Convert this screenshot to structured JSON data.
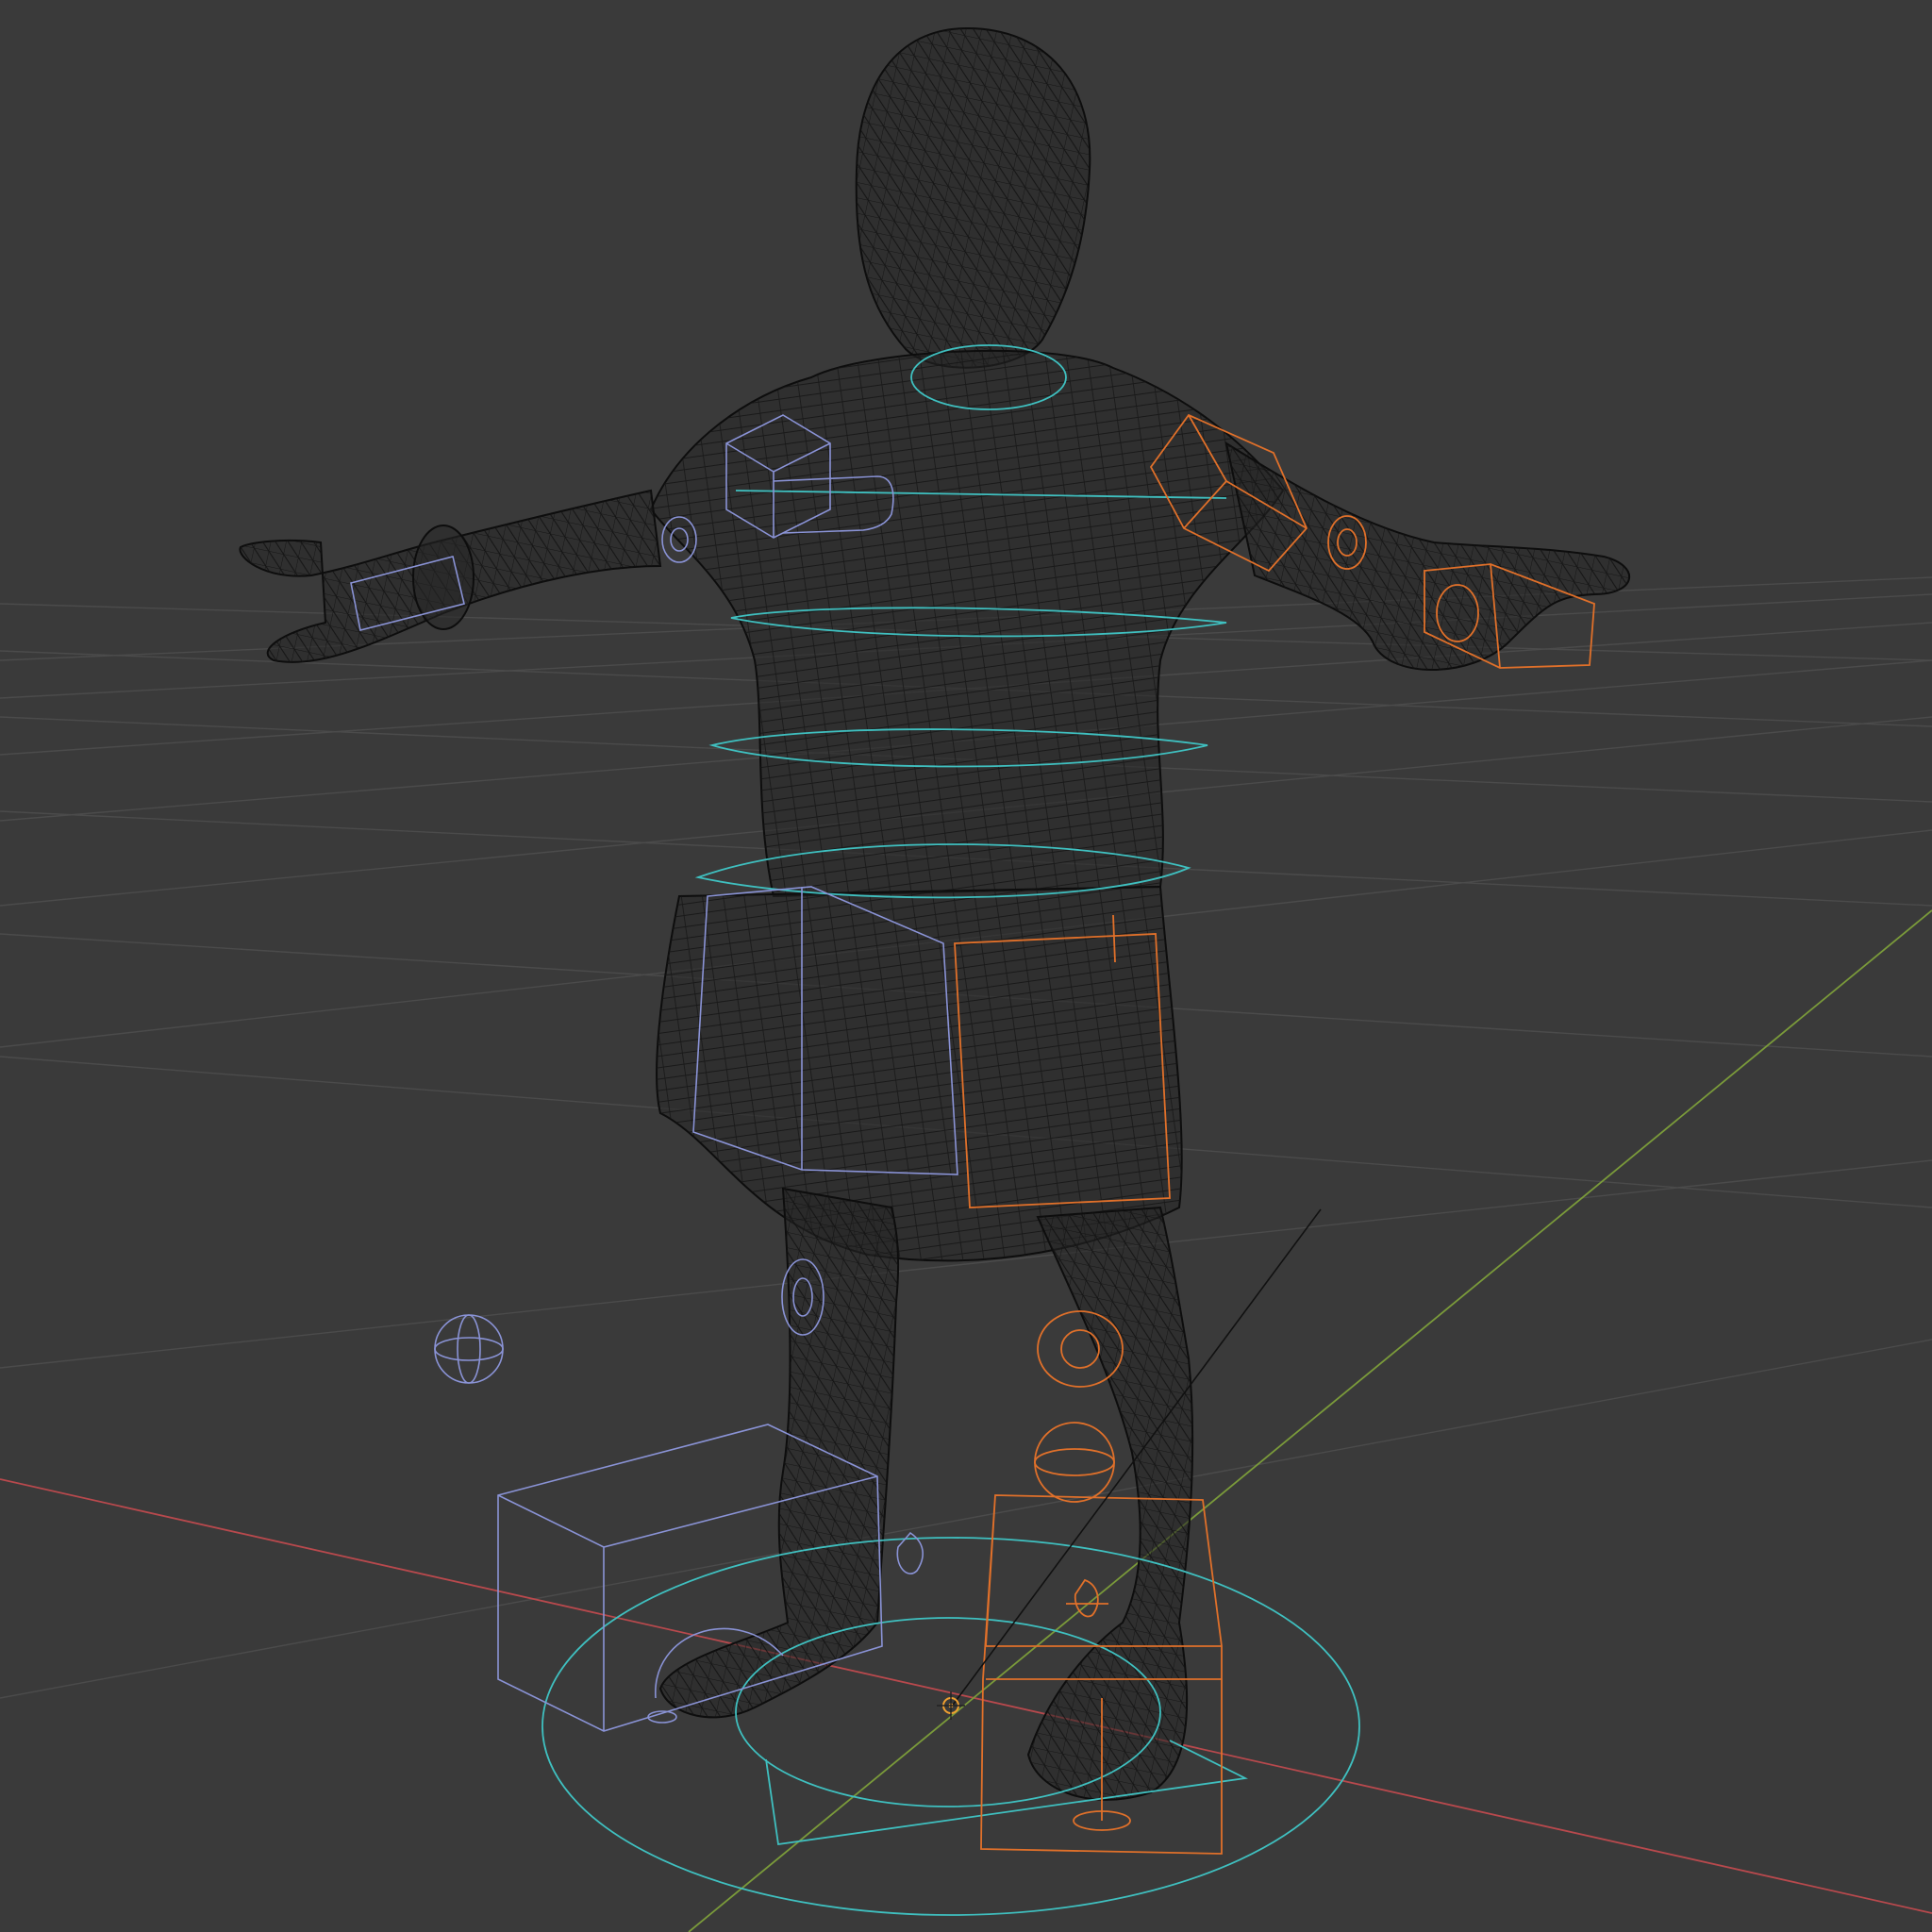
{
  "viewport": {
    "background": "#3a3a3a",
    "shading": "wireframe",
    "colors": {
      "grid": "#4b4b4b",
      "x_axis": "#b8494d",
      "y_axis": "#7a9a3a",
      "mesh": "#141414",
      "controller_left": "#8a93d6",
      "controller_right": "#e0702a",
      "controller_center": "#3fc0c0",
      "origin": "#f0a030"
    },
    "icons": {
      "origin_marker": "3d-cursor-icon"
    }
  }
}
